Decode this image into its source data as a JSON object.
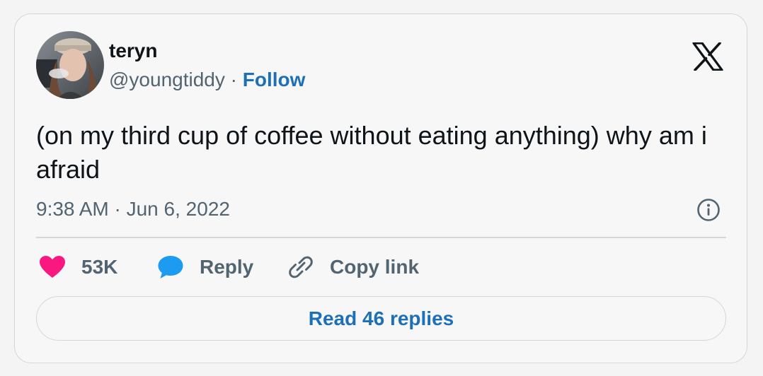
{
  "tweet": {
    "author": {
      "display_name": "teryn",
      "handle": "@youngtiddy",
      "separator": "·",
      "follow_label": "Follow"
    },
    "text": "(on my third cup of coffee without eating anything) why am i afraid",
    "timestamp": "9:38 AM · Jun 6, 2022"
  },
  "actions": {
    "like_count": "53K",
    "reply_label": "Reply",
    "copy_link_label": "Copy link"
  },
  "read_replies_label": "Read 46 replies",
  "icons": {
    "logo": "x-logo-icon",
    "info": "info-icon",
    "like": "heart-icon",
    "reply": "speech-bubble-icon",
    "copy": "link-icon"
  },
  "colors": {
    "like": "#f91880",
    "reply": "#1d9bf0",
    "link": "#1d70b8",
    "text_primary": "#0f1419",
    "text_secondary": "#536471",
    "border": "#d2d7db"
  }
}
